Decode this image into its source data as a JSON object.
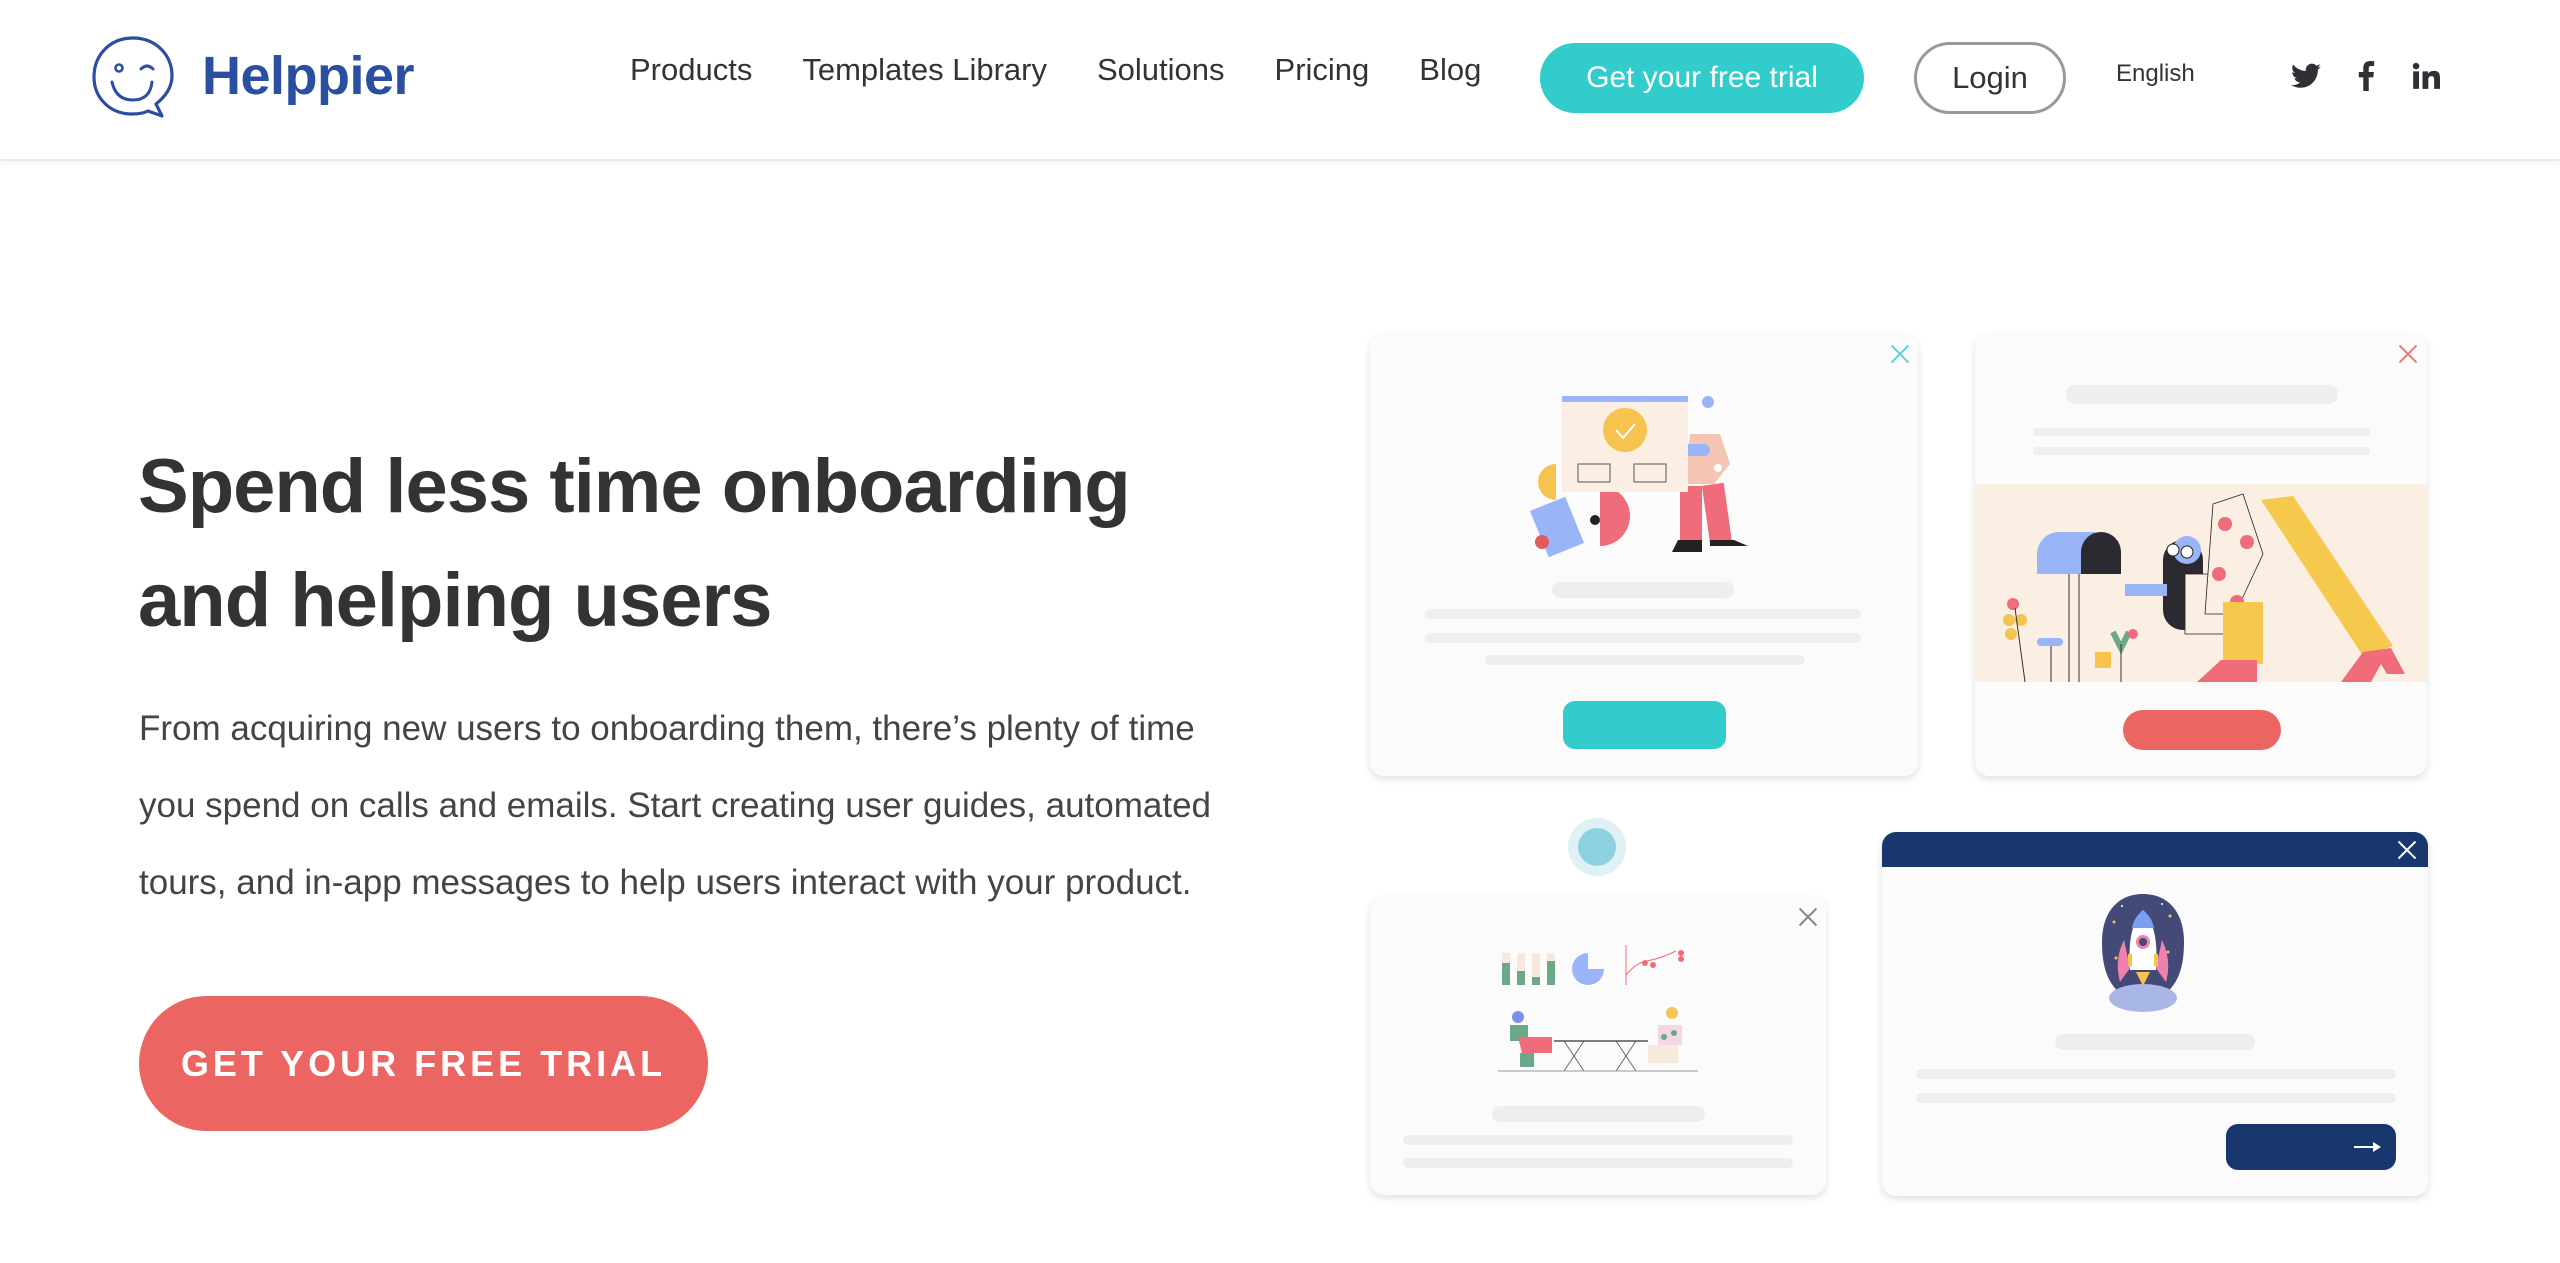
{
  "header": {
    "brand": "Helppier",
    "nav": [
      "Products",
      "Templates Library",
      "Solutions",
      "Pricing",
      "Blog"
    ],
    "trial_button": "Get your free trial",
    "login_button": "Login",
    "language": "English",
    "social": [
      "twitter-icon",
      "facebook-icon",
      "linkedin-icon"
    ]
  },
  "hero": {
    "title_line1": "Spend less time onboarding",
    "title_line2": "and helping users",
    "description_line1": "From acquiring new users to onboarding them, there’s plenty of time",
    "description_line2": "you spend on calls and emails. Start creating user guides, automated",
    "description_line3": "tours, and in-app messages to help users interact with your product.",
    "cta": "GET YOUR FREE TRIAL"
  },
  "colors": {
    "brand_blue": "#2b4fa0",
    "teal": "#33cccc",
    "coral": "#eb6662",
    "navy": "#17376e",
    "text": "#333333"
  },
  "illustrations": [
    {
      "name": "modal-preview-check",
      "accent": "#33cccc",
      "close": "close-icon"
    },
    {
      "name": "modal-preview-mailbox",
      "accent": "#eb6662",
      "close": "close-icon"
    },
    {
      "name": "tooltip-preview-meeting",
      "accent": "#8ed2e1",
      "close": "close-icon"
    },
    {
      "name": "modal-preview-rocket",
      "accent": "#17376e",
      "close": "close-icon",
      "button_icon": "arrow-right-icon"
    }
  ]
}
